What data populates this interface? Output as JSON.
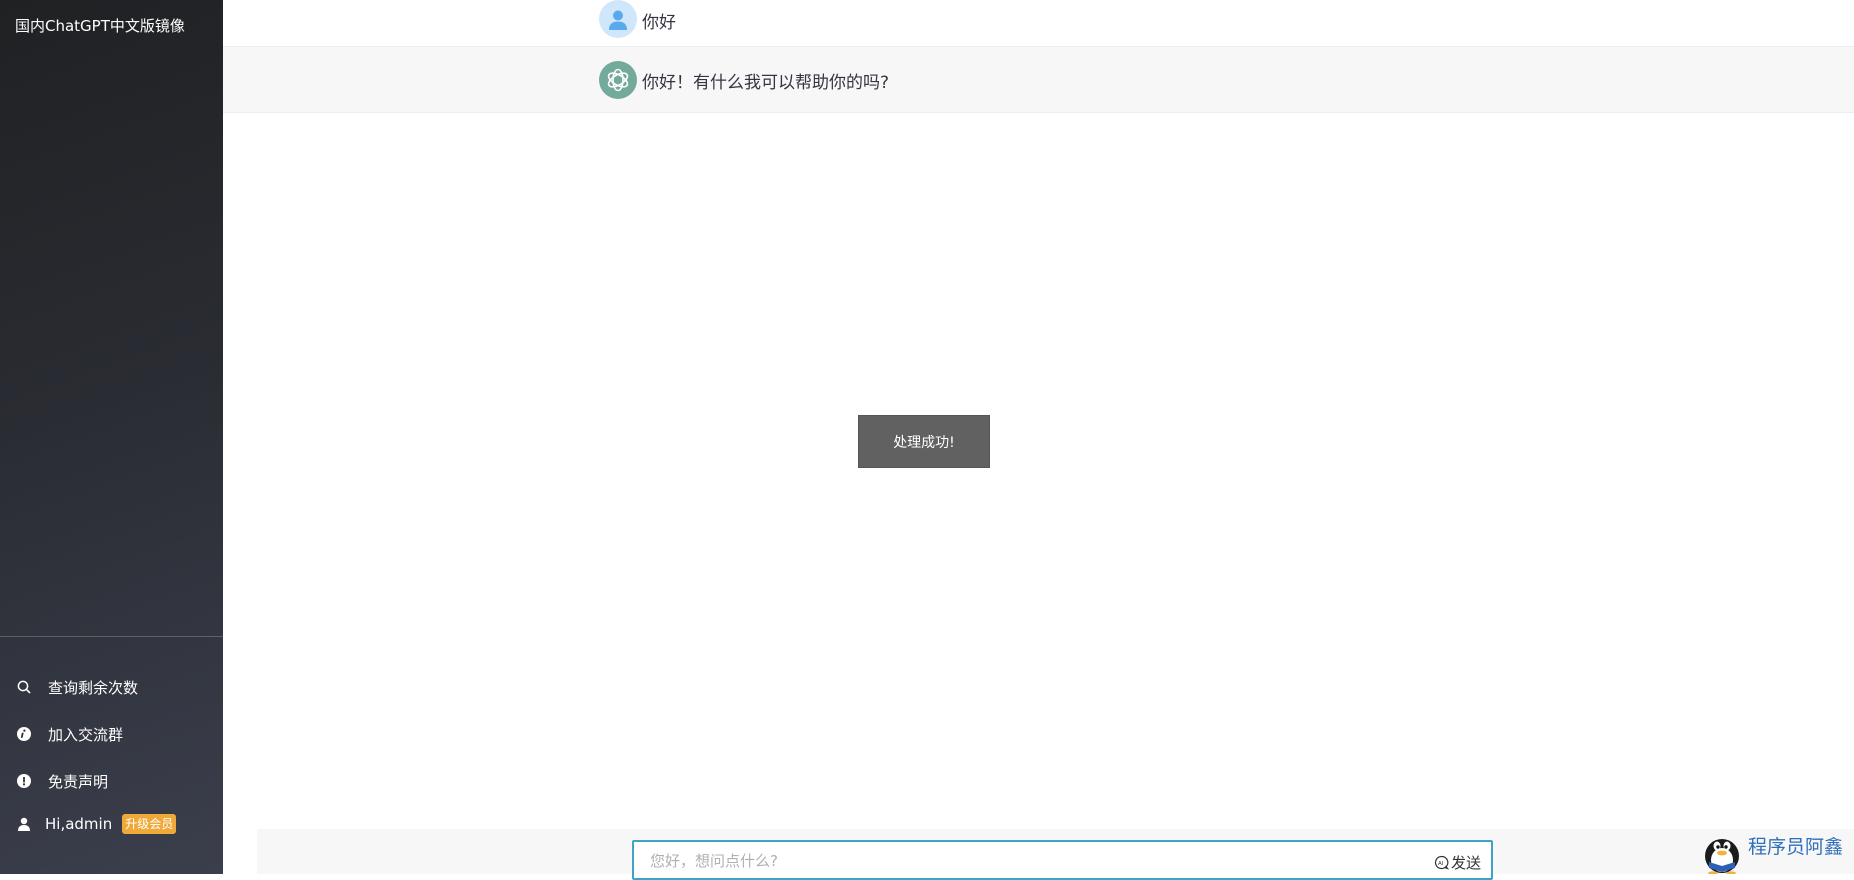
{
  "sidebar": {
    "brand": "国内ChatGPT中文版镜像",
    "menu": [
      {
        "label": "查询剩余次数",
        "icon": "search-icon"
      },
      {
        "label": "加入交流群",
        "icon": "info-circle-icon"
      },
      {
        "label": "免责声明",
        "icon": "exclamation-circle-icon"
      }
    ],
    "user": {
      "label": "Hi,admin",
      "badge": "升级会员",
      "icon": "user-icon",
      "badge_color": "#f0a938"
    }
  },
  "conversation": [
    {
      "role": "user",
      "text": "你好",
      "avatar_icon": "user-avatar-icon"
    },
    {
      "role": "assistant",
      "text": "你好！有什么我可以帮助你的吗?",
      "avatar_icon": "openai-logo-icon",
      "avatar_color": "#74aa9c"
    }
  ],
  "toast": {
    "text": "处理成功!"
  },
  "composer": {
    "placeholder": "您好，想问点什么?",
    "value": "",
    "send_label": "发送",
    "send_icon": "ai-chat-icon",
    "border_color": "#3fa3c8"
  },
  "watermark": {
    "text": "程序员阿鑫",
    "icon": "qq-penguin-icon"
  }
}
